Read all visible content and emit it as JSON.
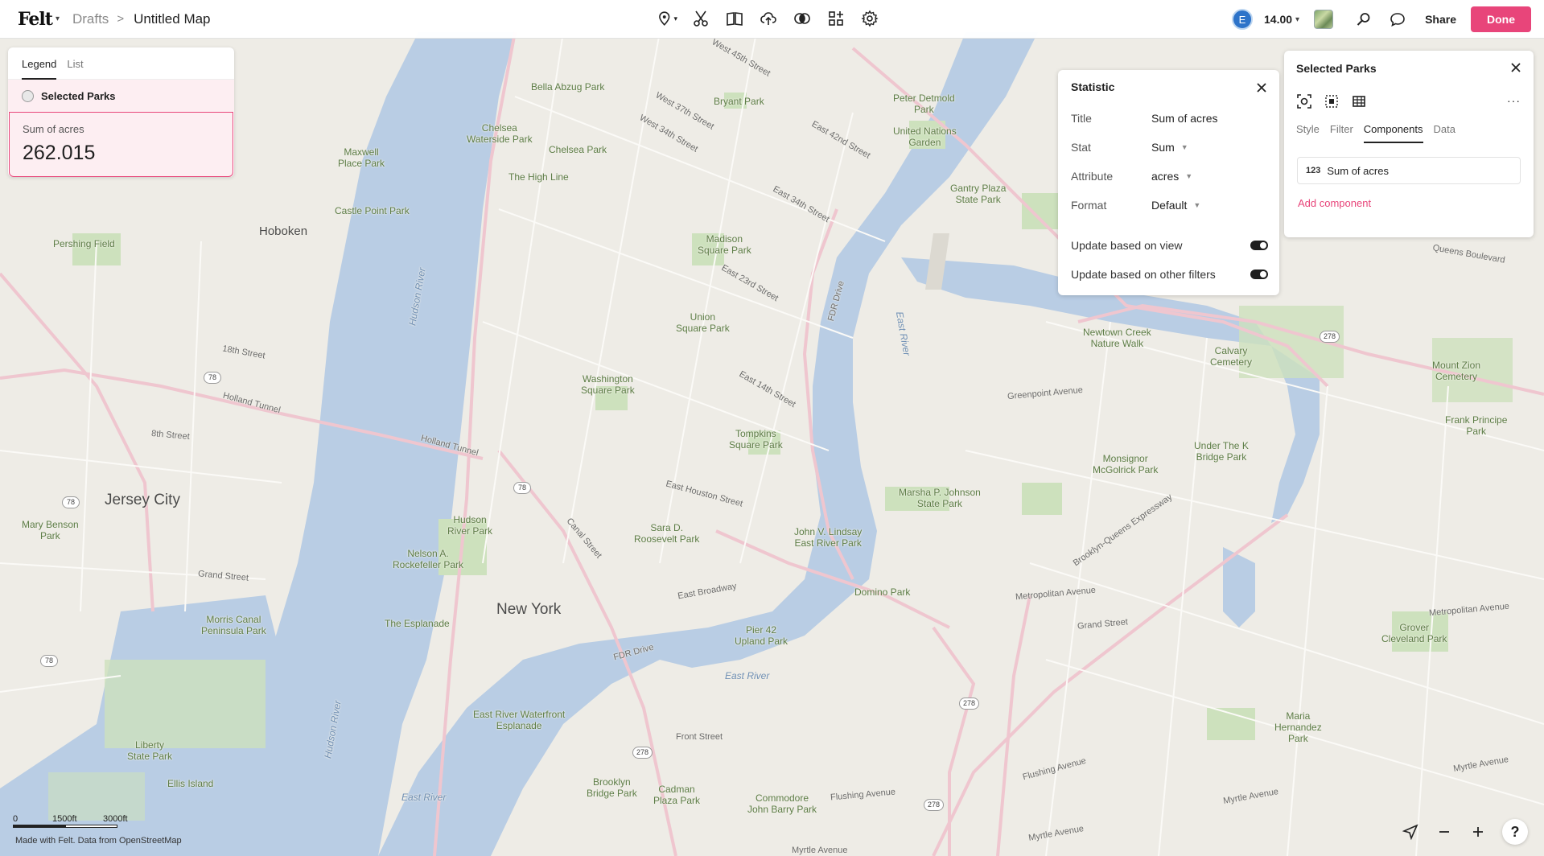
{
  "topbar": {
    "logo": "Felt",
    "breadcrumb_parent": "Drafts",
    "breadcrumb_sep": ">",
    "map_title": "Untitled Map",
    "avatar_initial": "E",
    "zoom": "14.00",
    "share_label": "Share",
    "done_label": "Done",
    "accent_color": "#e8457a"
  },
  "legend": {
    "tabs": [
      "Legend",
      "List"
    ],
    "layer_name": "Selected Parks",
    "stat_title": "Sum of acres",
    "stat_value": "262.015"
  },
  "statistic_panel": {
    "title": "Statistic",
    "rows": [
      {
        "label": "Title",
        "value": "Sum of acres"
      },
      {
        "label": "Stat",
        "value": "Sum"
      },
      {
        "label": "Attribute",
        "value": "acres"
      },
      {
        "label": "Format",
        "value": "Default"
      }
    ],
    "toggles": [
      {
        "label": "Update based on view",
        "on": true
      },
      {
        "label": "Update based on other filters",
        "on": true
      }
    ]
  },
  "parks_panel": {
    "title": "Selected Parks",
    "more": "···",
    "tabs": [
      "Style",
      "Filter",
      "Components",
      "Data"
    ],
    "component_num_icon": "123",
    "component_label": "Sum of acres",
    "add_component": "Add component"
  },
  "scale": {
    "t0": "0",
    "t1": "1500ft",
    "t2": "3000ft"
  },
  "attribution": "Made with Felt. Data from OpenStreetMap",
  "map_labels": {
    "bella": "Bella Abzug Park",
    "bryant": "Bryant Park",
    "peter": "Peter Detmold\nPark",
    "united": "United Nations\nGarden",
    "gantry": "Gantry Plaza\nState Park",
    "chelsea_wf": "Chelsea\nWaterside Park",
    "chelsea": "Chelsea Park",
    "highline": "The High Line",
    "maxwell": "Maxwell\nPlace Park",
    "castle": "Castle Point Park",
    "hoboken": "Hoboken",
    "pershing": "Pershing Field",
    "madison": "Madison\nSquare Park",
    "union": "Union\nSquare Park",
    "washington": "Washington\nSquare Park",
    "tompkins": "Tompkins\nSquare Park",
    "newtown": "Newtown Creek\nNature Walk",
    "calvary": "Calvary\nCemetery",
    "mountzion": "Mount Zion\nCemetery",
    "frank": "Frank Principe\nPark",
    "monsignor": "Monsignor\nMcGolrick Park",
    "underk": "Under The K\nBridge Park",
    "marsha": "Marsha P. Johnson\nState Park",
    "jersey": "Jersey City",
    "marybenson": "Mary Benson\nPark",
    "hudsonriver_park": "Hudson\nRiver Park",
    "nelson": "Nelson A.\nRockefeller Park",
    "sara": "Sara D.\nRoosevelt Park",
    "lindsay": "John V. Lindsay\nEast River Park",
    "domino": "Domino Park",
    "newyork": "New York",
    "esplanade": "The Esplanade",
    "morris": "Morris Canal\nPeninsula Park",
    "pier42": "Pier 42\nUpland Park",
    "grover": "Grover\nCleveland Park",
    "eastriver_wf": "East River Waterfront\nEsplanade",
    "maria": "Maria\nHernandez\nPark",
    "liberty": "Liberty\nState Park",
    "ellis": "Ellis Island",
    "brooklynbridge": "Brooklyn\nBridge Park",
    "cadman": "Cadman\nPlaza Park",
    "commodore": "Commodore\nJohn Barry Park",
    "hudson_river": "Hudson River",
    "east_river": "East River",
    "east_river2": "East River",
    "east_river3": "East River",
    "hudson_river2": "Hudson River",
    "holland": "Holland Tunnel",
    "queens_blvd": "Queens Boulevard",
    "greenpoint": "Greenpoint Avenue",
    "grand": "Grand Street",
    "metropolitan": "Metropolitan Avenue",
    "flushing": "Flushing Avenue",
    "myrtle": "Myrtle Avenue",
    "canal": "Canal Street",
    "houston": "East Houston Street",
    "broadway_e": "East Broadway",
    "w45": "West 45th Street",
    "w37": "West 37th Street",
    "w34": "West 34th Street",
    "e34": "East 34th Street",
    "e23": "East 23rd Street",
    "e14": "East 14th Street",
    "e42": "East 42nd Street",
    "fdr": "FDR Drive",
    "fdr2": "FDR Drive",
    "bqe": "Brooklyn-Queens Expressway",
    "w8": "8th Street",
    "w18": "18th Street",
    "grand_jc": "Grand Street",
    "front": "Front Street",
    "s278": "278",
    "s78": "78"
  }
}
